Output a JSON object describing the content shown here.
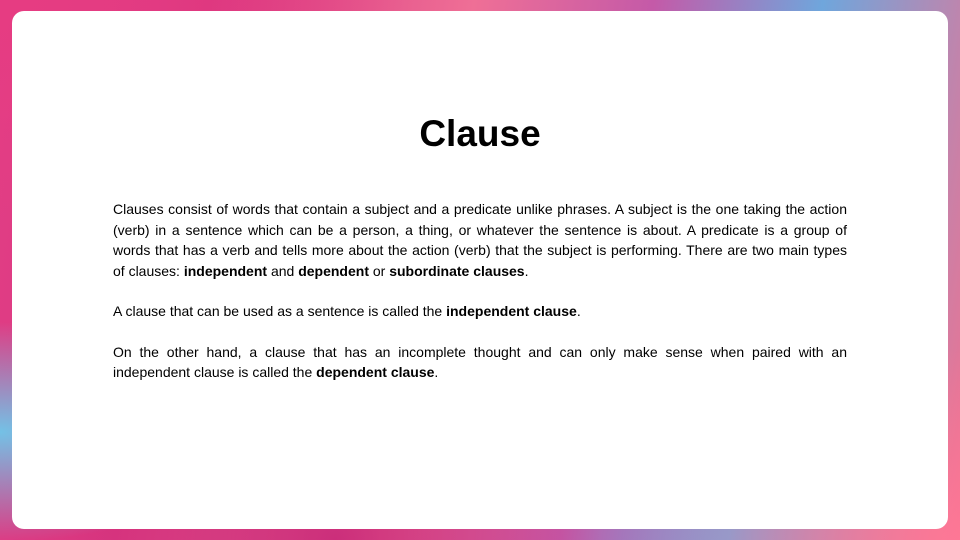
{
  "slide": {
    "title": "Clause",
    "paragraph1": {
      "text_a": "Clauses consist of words that contain a subject and a predicate unlike phrases. A subject is the one taking the action (verb) in a sentence which can be a person, a thing, or whatever the sentence is about. A predicate is a group of words that has a verb and tells more about the action (verb) that the subject is performing. There are two main types of clauses: ",
      "bold_independent": "independent",
      "text_and": " and ",
      "bold_dependent": "dependent",
      "text_or": " or ",
      "bold_subordinate": "subordinate clauses",
      "text_end": "."
    },
    "paragraph2": {
      "text_a": "A clause that can be used as a sentence is called the ",
      "bold_term": "independent clause",
      "text_end": "."
    },
    "paragraph3": {
      "text_a": "On the other hand, a clause that has an incomplete thought and can only make sense when paired with an independent clause is called the ",
      "bold_term": "dependent clause",
      "text_end": "."
    }
  },
  "colors": {
    "frame_pink": "#e23f86",
    "frame_blue": "#6fa6dc",
    "frame_coral": "#f2708f",
    "card_background": "#ffffff",
    "text": "#000000"
  }
}
